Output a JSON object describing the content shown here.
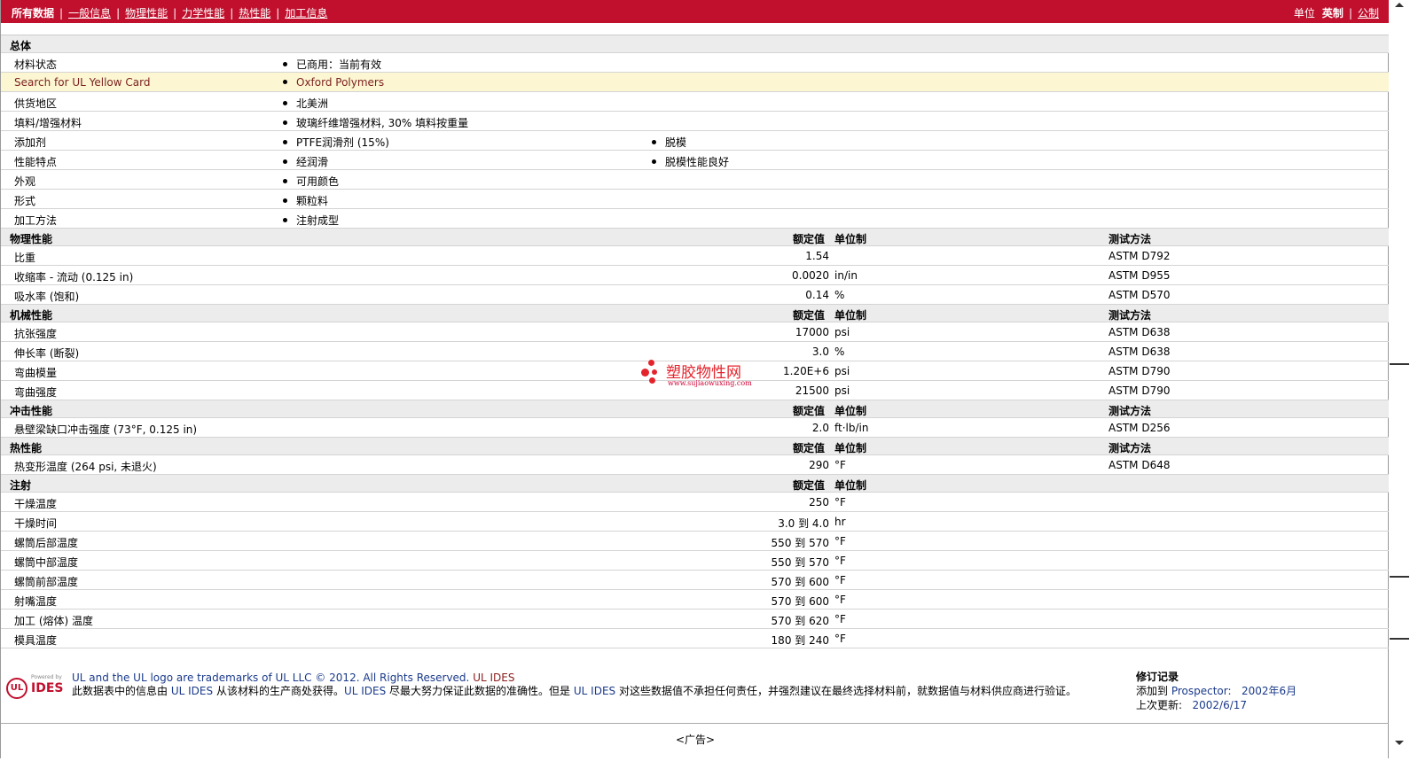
{
  "nav": {
    "items": [
      "所有数据",
      "一般信息",
      "物理性能",
      "力学性能",
      "热性能",
      "加工信息"
    ],
    "sep": "|"
  },
  "units": {
    "label": "单位",
    "current": "英制",
    "sep": "|",
    "alt": "公制"
  },
  "general": {
    "title": "总体",
    "rows": [
      {
        "label": "材料状态",
        "v1": "已商用：当前有效",
        "v2": ""
      },
      {
        "label": "Search for UL Yellow Card",
        "v1": "Oxford Polymers",
        "v2": ""
      },
      {
        "label": "供货地区",
        "v1": "北美洲",
        "v2": ""
      },
      {
        "label": "填料/增强材料",
        "v1": "玻璃纤维增强材料, 30% 填料按重量",
        "v2": ""
      },
      {
        "label": "添加剂",
        "v1": "PTFE润滑剂 (15%)",
        "v2": "脱模"
      },
      {
        "label": "性能特点",
        "v1": "经润滑",
        "v2": "脱模性能良好"
      },
      {
        "label": "外观",
        "v1": "可用颜色",
        "v2": ""
      },
      {
        "label": "形式",
        "v1": "颗粒料",
        "v2": ""
      },
      {
        "label": "加工方法",
        "v1": "注射成型",
        "v2": ""
      }
    ]
  },
  "headers": {
    "value": "额定值",
    "unit": "单位制",
    "method": "测试方法"
  },
  "physical": {
    "title": "物理性能",
    "rows": [
      {
        "label": "比重",
        "value": "1.54",
        "unit": "",
        "method": "ASTM D792"
      },
      {
        "label": "收缩率 - 流动 (0.125 in)",
        "value": "0.0020",
        "unit": "in/in",
        "method": "ASTM D955"
      },
      {
        "label": "吸水率 (饱和)",
        "value": "0.14",
        "unit": "%",
        "method": "ASTM D570"
      }
    ]
  },
  "mechanical": {
    "title": "机械性能",
    "rows": [
      {
        "label": "抗张强度",
        "value": "17000",
        "unit": "psi",
        "method": "ASTM D638"
      },
      {
        "label": "伸长率 (断裂)",
        "value": "3.0",
        "unit": "%",
        "method": "ASTM D638"
      },
      {
        "label": "弯曲模量",
        "value": "1.20E+6",
        "unit": "psi",
        "method": "ASTM D790"
      },
      {
        "label": "弯曲强度",
        "value": "21500",
        "unit": "psi",
        "method": "ASTM D790"
      }
    ]
  },
  "impact": {
    "title": "冲击性能",
    "rows": [
      {
        "label": "悬壁梁缺口冲击强度 (73°F, 0.125 in)",
        "value": "2.0",
        "unit": "ft·lb/in",
        "method": "ASTM D256"
      }
    ]
  },
  "thermal": {
    "title": "热性能",
    "rows": [
      {
        "label": "热变形温度 (264 psi, 未退火)",
        "value": "290",
        "unit": "°F",
        "method": "ASTM D648"
      }
    ]
  },
  "injection": {
    "title": "注射",
    "rows": [
      {
        "label": "干燥温度",
        "value": "250",
        "unit": "°F"
      },
      {
        "label": "干燥时间",
        "value": "3.0 到  4.0",
        "unit": "hr"
      },
      {
        "label": "螺筒后部温度",
        "value": "550 到  570",
        "unit": "°F"
      },
      {
        "label": "螺筒中部温度",
        "value": "550 到  570",
        "unit": "°F"
      },
      {
        "label": "螺筒前部温度",
        "value": "570 到  600",
        "unit": "°F"
      },
      {
        "label": "射嘴温度",
        "value": "570 到  600",
        "unit": "°F"
      },
      {
        "label": "加工 (熔体) 温度",
        "value": "570 到  620",
        "unit": "°F"
      },
      {
        "label": "模具温度",
        "value": "180 到  240",
        "unit": "°F"
      }
    ]
  },
  "watermark": {
    "name": "塑胶物性网",
    "url": "www.sujiaowuxing.com"
  },
  "footer": {
    "logo_powered": "Powered by",
    "logo_ul": "UL",
    "logo_ides": "IDES",
    "line1": "UL and the UL logo are trademarks of UL LLC © 2012. All Rights Reserved.",
    "line1_link": "UL IDES",
    "line2_a": "此数据表中的信息由",
    "line2_b": "UL IDES",
    "line2_c": "从该材料的生产商处获得。",
    "line2_d": "UL IDES",
    "line2_e": "尽最大努力保证此数据的准确性。但是",
    "line2_f": "UL IDES",
    "line2_g": "对这些数据值不承担任何责任，并强烈建议在最终选择材料前，就数据值与材料供应商进行验证。",
    "rev_title": "修订记录",
    "rev_added_label": "添加到",
    "rev_added_src": "Prospector:",
    "rev_added_date": "2002年6月",
    "rev_updated_label": "上次更新:",
    "rev_updated_date": "2002/6/17"
  },
  "ad": "<广告>",
  "colors": {
    "brand": "#c0102e",
    "highlight": "#fcf7d2",
    "section": "#ececec"
  }
}
